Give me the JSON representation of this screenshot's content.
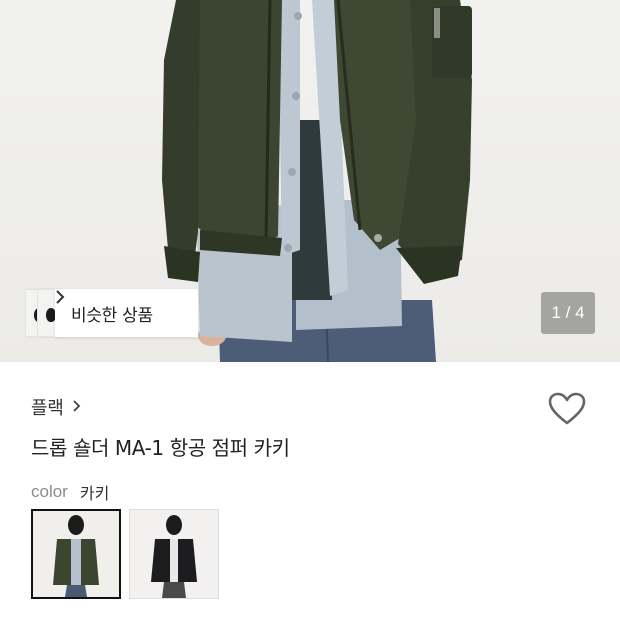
{
  "hero": {
    "similar_label": "비슷한 상품",
    "page_indicator": "1 / 4"
  },
  "product": {
    "brand": "플랙",
    "title": "드롭 숄더 MA-1 항공 점퍼 카키",
    "color_key": "color",
    "color_value": "카키"
  },
  "swatches": [
    {
      "name": "khaki",
      "selected": true
    },
    {
      "name": "black",
      "selected": false
    }
  ],
  "icons": {
    "wishlist": "heart-icon",
    "brand_chevron": "chevron-right-icon",
    "similar_chevron": "chevron-right-icon"
  },
  "colors": {
    "jacket_khaki": "#3b4330",
    "jacket_black": "#1c1c1e",
    "shirt": "#b7c3cf",
    "denim": "#4a5a75"
  }
}
